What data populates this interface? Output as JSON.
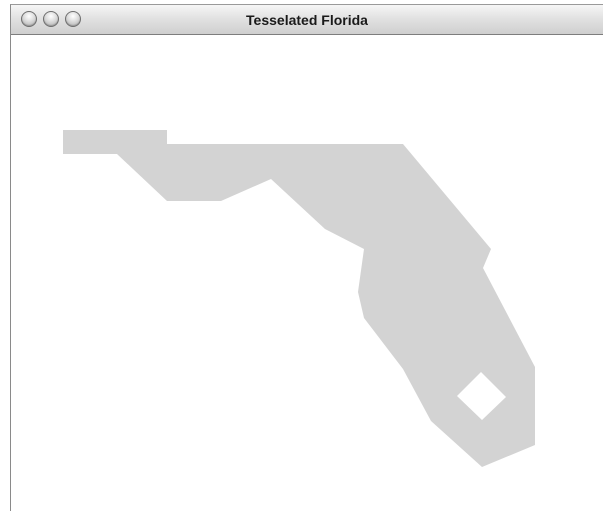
{
  "window": {
    "title": "Tesselated Florida",
    "fill_color": "#d3d3d3",
    "hole_color": "#ffffff",
    "buttons": [
      "close-button",
      "minimize-button",
      "zoom-button"
    ]
  }
}
